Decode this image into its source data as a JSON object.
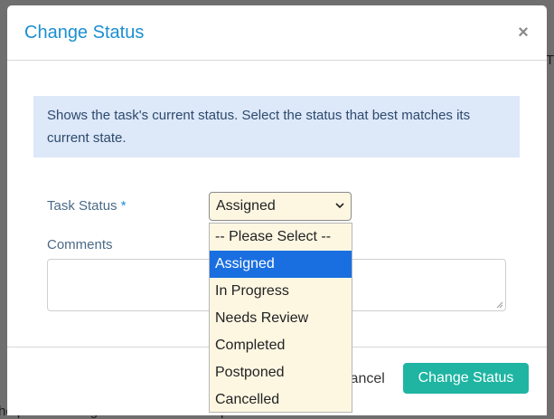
{
  "background": {
    "partial_text": "he phone asking for feedback and impressions from",
    "partial_letter": "T"
  },
  "modal": {
    "title": "Change Status",
    "close_symbol": "×",
    "info_text": "Shows the task's current status. Select the status that best matches its current state.",
    "task_status_label": "Task Status",
    "required_marker": "*",
    "task_status_value": "Assigned",
    "comments_label": "Comments",
    "comments_value": "",
    "cancel_label": "Cancel",
    "submit_label": "Change Status"
  },
  "dropdown": {
    "options": [
      "-- Please Select --",
      "Assigned",
      "In Progress",
      "Needs Review",
      "Completed",
      "Postponed",
      "Cancelled"
    ],
    "selected_index": 1
  },
  "colors": {
    "title": "#1c8fd1",
    "info_bg": "#dde8f9",
    "select_bg": "#fdf7e2",
    "selected_option": "#1a6fe0",
    "submit_button": "#1fb5a2"
  },
  "icons": {
    "close": "close-icon",
    "select_chevron": "chevron-down-icon",
    "resize": "resize-grip-icon"
  }
}
